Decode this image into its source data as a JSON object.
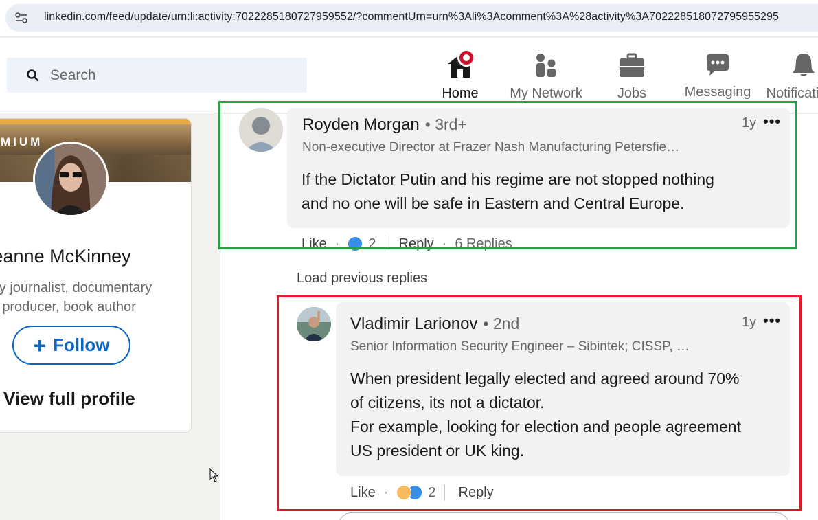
{
  "browser": {
    "url": "linkedin.com/feed/update/urn:li:activity:7022285180727959552/?commentUrn=urn%3Ali%3Acomment%3A%28activity%3A702228518072795955295"
  },
  "header": {
    "search_placeholder": "Search",
    "nav": [
      {
        "label": "Home",
        "icon": "home-icon",
        "active": true
      },
      {
        "label": "My Network",
        "icon": "my-network-icon",
        "active": false
      },
      {
        "label": "Jobs",
        "icon": "jobs-icon",
        "active": false
      },
      {
        "label": "Messaging",
        "icon": "messaging-icon",
        "active": false
      },
      {
        "label": "Notifications",
        "icon": "notifications-icon",
        "active": false
      }
    ]
  },
  "profile_card": {
    "banner_text": "MIUM",
    "name": "Jeanne McKinney",
    "headline_line1": "ary journalist, documentary",
    "headline_line2": "m producer, book author",
    "follow_label": "Follow",
    "view_profile_label": "View full profile"
  },
  "comments": [
    {
      "author": "Royden Morgan",
      "degree": "• 3rd+",
      "headline": "Non-executive Director at Frazer Nash Manufacturing Petersfie…",
      "time": "1y",
      "more": "•••",
      "text_line1": "If the Dictator Putin and his regime are not stopped nothing",
      "text_line2": "and no one will be safe in Eastern and Central Europe.",
      "like_label": "Like",
      "reaction_count": "2",
      "reply_label": "Reply",
      "replies_label": "6 Replies"
    },
    {
      "author": "Vladimir Larionov",
      "degree": "• 2nd",
      "headline": "Senior Information Security Engineer – Sibintek; CISSP, …",
      "time": "1y",
      "more": "•••",
      "text_line1": "When president legally elected and agreed around 70%",
      "text_line2": "of citizens, its not a dictator.",
      "text_line3": "For example, looking for election and people agreement",
      "text_line4": "US president or UK king.",
      "like_label": "Like",
      "reaction_count": "2",
      "reply_label": "Reply"
    }
  ],
  "load_previous_label": "Load previous replies",
  "colors": {
    "linkedin_blue": "#0a66c2",
    "highlight_green": "#23a244",
    "highlight_red": "#e01b24",
    "notification_badge": "#cb112d"
  }
}
